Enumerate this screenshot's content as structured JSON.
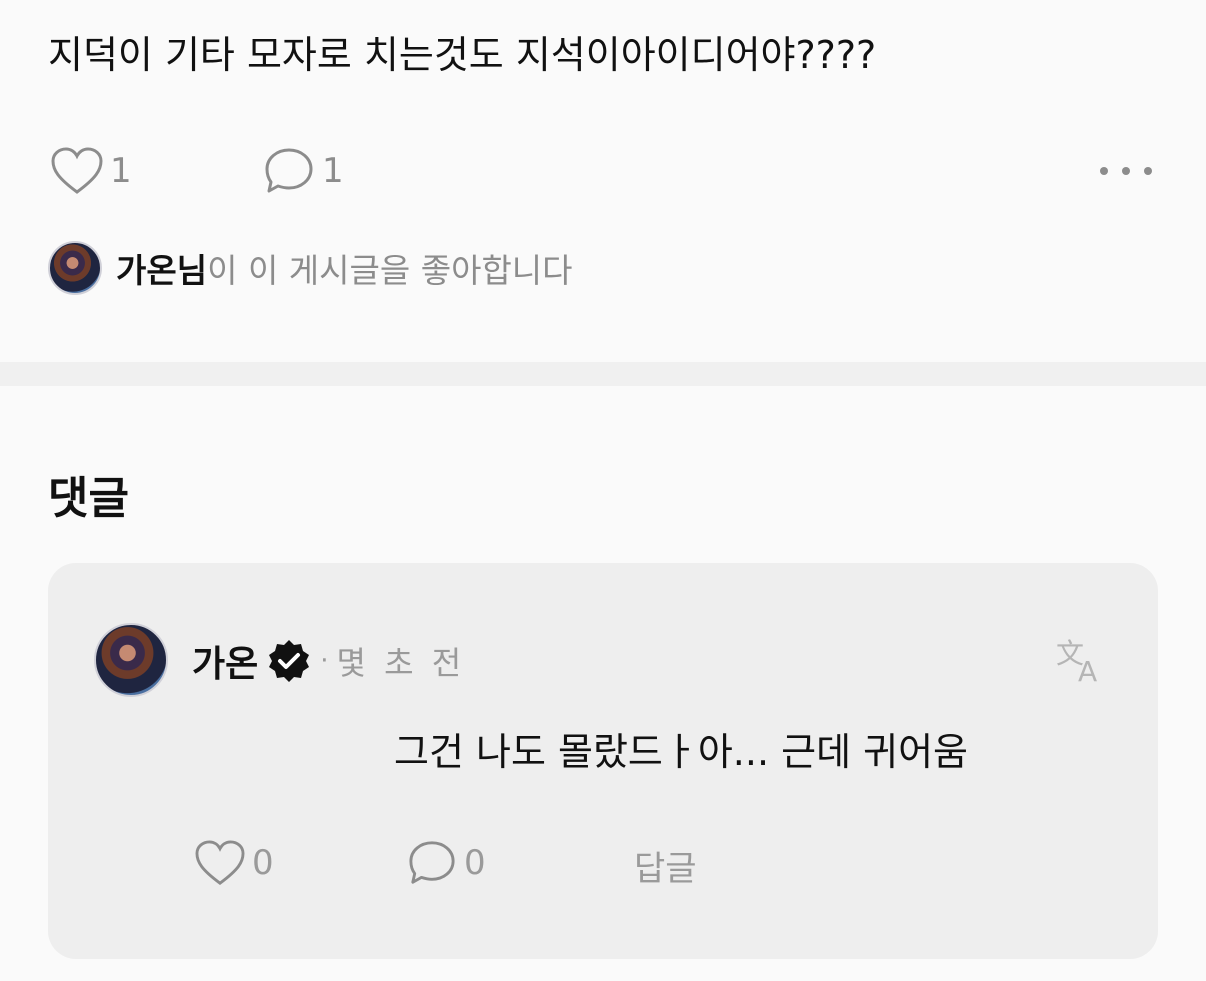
{
  "post": {
    "text": "지덕이 기타 모자로 치는것도 지석이아이디어야????",
    "like_count": "1",
    "comment_count": "1"
  },
  "liked_by": {
    "name": "가온님",
    "suffix": "이 이 게시글을 좋아합니다"
  },
  "comments_section": {
    "title": "댓글"
  },
  "comment": {
    "author": "가온",
    "separator": "·",
    "time": "몇 초 전",
    "text": "그건 나도 몰랐드ㅏ아... 근데 귀어움",
    "like_count": "0",
    "reply_count": "0",
    "reply_label": "답글"
  },
  "icons": {
    "like": "heart-icon",
    "comment": "comment-bubble-icon",
    "more": "more-horizontal-icon",
    "verified": "verified-badge-icon",
    "translate": "translate-icon"
  },
  "colors": {
    "background": "#fafafa",
    "card": "#eeeeee",
    "muted": "#8c8c8c",
    "text": "#111111"
  }
}
